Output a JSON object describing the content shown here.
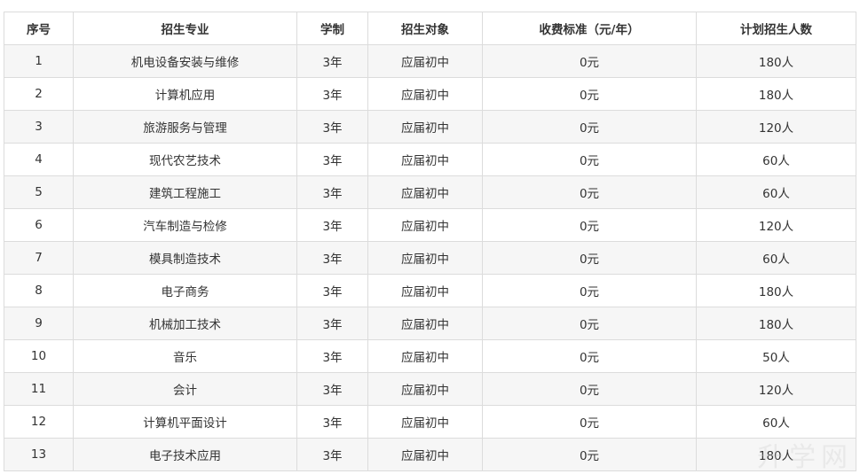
{
  "table": {
    "headers": [
      "序号",
      "招生专业",
      "学制",
      "招生对象",
      "收费标准（元/年）",
      "计划招生人数"
    ],
    "rows": [
      [
        "1",
        "机电设备安装与维修",
        "3年",
        "应届初中",
        "0元",
        "180人"
      ],
      [
        "2",
        "计算机应用",
        "3年",
        "应届初中",
        "0元",
        "180人"
      ],
      [
        "3",
        "旅游服务与管理",
        "3年",
        "应届初中",
        "0元",
        "120人"
      ],
      [
        "4",
        "现代农艺技术",
        "3年",
        "应届初中",
        "0元",
        "60人"
      ],
      [
        "5",
        "建筑工程施工",
        "3年",
        "应届初中",
        "0元",
        "60人"
      ],
      [
        "6",
        "汽车制造与检修",
        "3年",
        "应届初中",
        "0元",
        "120人"
      ],
      [
        "7",
        "模具制造技术",
        "3年",
        "应届初中",
        "0元",
        "60人"
      ],
      [
        "8",
        "电子商务",
        "3年",
        "应届初中",
        "0元",
        "180人"
      ],
      [
        "9",
        "机械加工技术",
        "3年",
        "应届初中",
        "0元",
        "180人"
      ],
      [
        "10",
        "音乐",
        "3年",
        "应届初中",
        "0元",
        "50人"
      ],
      [
        "11",
        "会计",
        "3年",
        "应届初中",
        "0元",
        "120人"
      ],
      [
        "12",
        "计算机平面设计",
        "3年",
        "应届初中",
        "0元",
        "60人"
      ],
      [
        "13",
        "电子技术应用",
        "3年",
        "应届初中",
        "0元",
        "180人"
      ]
    ]
  },
  "watermark": "升学网"
}
